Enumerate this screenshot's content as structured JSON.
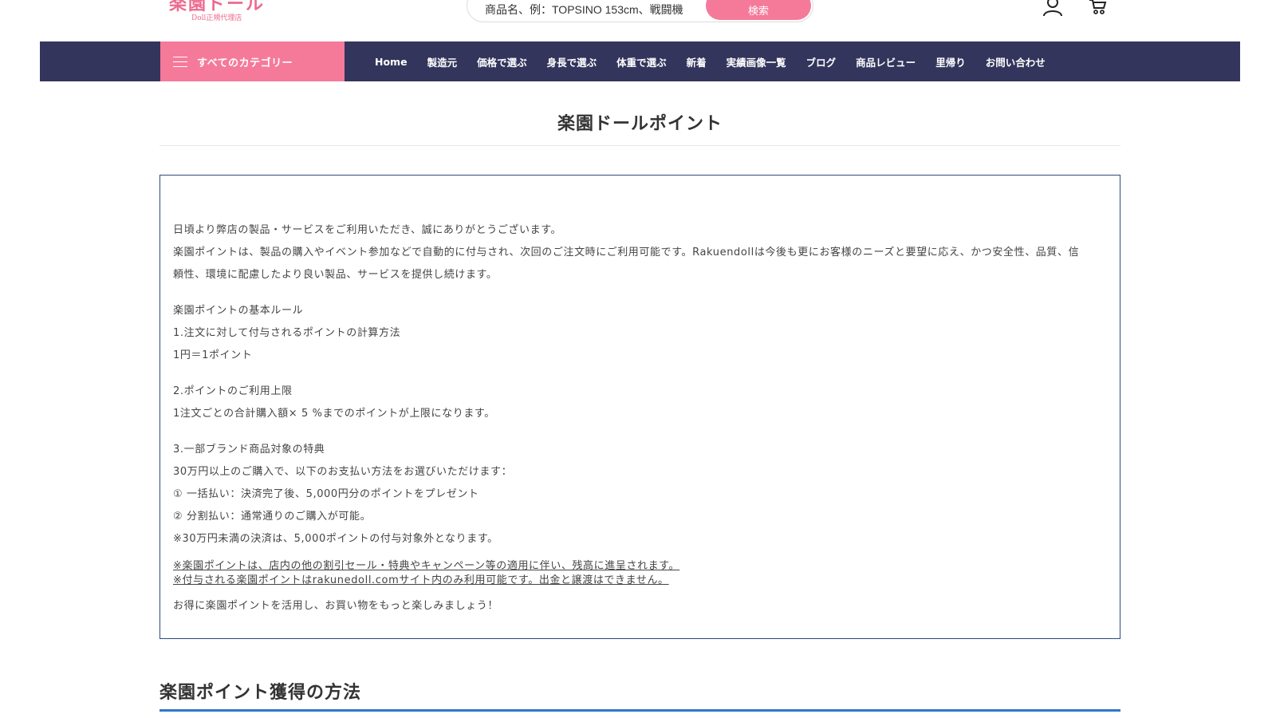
{
  "header": {
    "logo_text": "楽園ドール",
    "logo_subtext": "Doll正規代理店",
    "search_placeholder": "商品名、例：TOPSINO 153cm、戦闘機",
    "search_button": "検索"
  },
  "nav": {
    "category_button": "すべてのカテゴリー",
    "items": [
      "Home",
      "製造元",
      "価格で選ぶ",
      "身長で選ぶ",
      "体重で選ぶ",
      "新着",
      "実績画像一覧",
      "ブログ",
      "商品レビュー",
      "里帰り",
      "お問い合わせ"
    ]
  },
  "page": {
    "title": "楽園ドールポイント",
    "intro": [
      "日頃より弊店の製品・サービスをご利用いただき、誠にありがとうございます。",
      "楽園ポイントは、製品の購入やイベント参加などで自動的に付与され、次回のご注文時にご利用可能です。Rakuendollは今後も更にお客様のニーズと要望に応え、かつ安全性、品質、信",
      "頼性、環境に配慮したより良い製品、サービスを提供し続けます。"
    ],
    "rules_heading": "楽園ポイントの基本ルール",
    "rule1_title": "1.注文に対して付与されるポイントの計算方法",
    "rule1_body": "1円＝1ポイント",
    "rule2_title": "2.ポイントのご利用上限",
    "rule2_body": "1注文ごとの合計購入額× 5 %までのポイントが上限になります。",
    "rule3_title": "3.一部ブランド商品対象の特典",
    "rule3_lines": [
      "30万円以上のご購入で、以下のお支払い方法をお選びいただけます：",
      "① 一括払い：決済完了後、5,000円分のポイントをプレゼント",
      "② 分割払い：通常通りのご購入が可能。",
      "※30万円未満の決済は、5,000ポイントの付与対象外となります。"
    ],
    "notes": [
      "※楽園ポイントは、店内の他の割引セール・特典やキャンペーン等の適用に伴い、残高に進呈されます。",
      "※付与される楽園ポイントはrakunedoll.comサイト内のみ利用可能です。出金と譲渡はできません。"
    ],
    "closing": "お得に楽園ポイントを活用し、お買い物をもっと楽しみましょう！",
    "section_heading": "楽園ポイント獲得の方法"
  },
  "colors": {
    "nav_bg": "#33355c",
    "accent_pink": "#f57a9a",
    "box_border": "#2c4b80",
    "section_rule": "#2f78c9"
  }
}
